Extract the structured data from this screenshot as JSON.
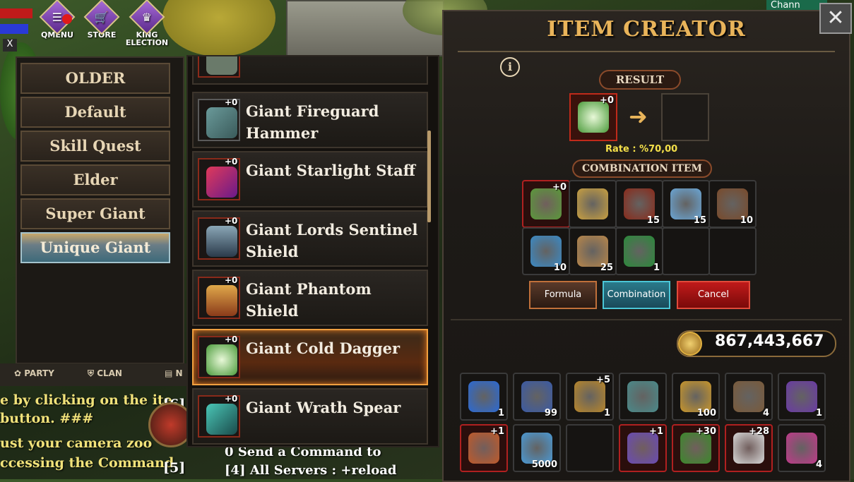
{
  "hud": {
    "buttons": [
      {
        "label": "QMENU",
        "icon": "menu-icon"
      },
      {
        "label": "STORE",
        "icon": "cart-icon"
      },
      {
        "label": "KING ELECTION",
        "icon": "crown-icon"
      }
    ],
    "close_small": "X",
    "channel_label": "Chann"
  },
  "categories": [
    {
      "label": "OLDER",
      "active": false
    },
    {
      "label": "Default",
      "active": false
    },
    {
      "label": "Skill Quest",
      "active": false
    },
    {
      "label": "Elder",
      "active": false
    },
    {
      "label": "Super Giant",
      "active": false
    },
    {
      "label": "Unique Giant",
      "active": true
    }
  ],
  "chat": {
    "tabs": [
      "PARTY",
      "CLAN",
      "N"
    ],
    "lines": [
      {
        "text": "e by clicking on the ite",
        "tag": "[6]"
      },
      {
        "text": "button. ###"
      },
      {
        "text": "ust your camera zoo"
      },
      {
        "text": "ccessing the Command",
        "tag": "[5]"
      },
      {
        "text": "Send a Command to",
        "tag": "0"
      },
      {
        "text": "All Servers : +reload",
        "tag": "[4]"
      }
    ]
  },
  "recipes": [
    {
      "name": "",
      "plus": "",
      "selected": false
    },
    {
      "name": "Giant Fireguard Hammer",
      "plus": "+0",
      "selected": false
    },
    {
      "name": "Giant Starlight Staff",
      "plus": "+0",
      "selected": false
    },
    {
      "name": "Giant Lords Sentinel Shield",
      "plus": "+0",
      "selected": false
    },
    {
      "name": "Giant Phantom Shield",
      "plus": "+0",
      "selected": false
    },
    {
      "name": "Giant Cold Dagger",
      "plus": "+0",
      "selected": true
    },
    {
      "name": "Giant Wrath Spear",
      "plus": "+0",
      "selected": false
    }
  ],
  "creator": {
    "title": "ITEM CREATOR",
    "close": "✕",
    "info": "i",
    "result_label": "RESULT",
    "result_item_plus": "+0",
    "rate": "Rate : %70,00",
    "combination_label": "COMBINATION ITEM",
    "combination_slots": [
      {
        "icon": "green-dagger-icon",
        "plus": "+0",
        "qty": "",
        "red": true,
        "color": "#5a9a3a"
      },
      {
        "icon": "gold-bar-icon",
        "plus": "",
        "qty": "",
        "red": false,
        "color": "#c9a040"
      },
      {
        "icon": "red-claw-icon",
        "plus": "",
        "qty": "15",
        "red": false,
        "color": "#8a2a1a"
      },
      {
        "icon": "crystal-icon",
        "plus": "",
        "qty": "15",
        "red": false,
        "color": "#6aa6d6"
      },
      {
        "icon": "scroll-book-icon",
        "plus": "",
        "qty": "10",
        "red": false,
        "color": "#7a4a2a"
      },
      {
        "icon": "blue-orb-icon",
        "plus": "",
        "qty": "10",
        "red": false,
        "color": "#3a8ac6"
      },
      {
        "icon": "gold-coin-icon",
        "plus": "",
        "qty": "25",
        "red": false,
        "color": "#b8864a"
      },
      {
        "icon": "green-triangle-icon",
        "plus": "",
        "qty": "1",
        "red": false,
        "color": "#2a8a3a"
      },
      {
        "icon": "",
        "plus": "",
        "qty": "",
        "red": false,
        "color": ""
      },
      {
        "icon": "",
        "plus": "",
        "qty": "",
        "red": false,
        "color": ""
      }
    ],
    "buttons": {
      "formula": "Formula",
      "combination": "Combination",
      "cancel": "Cancel"
    },
    "gold": "867,443,667"
  },
  "inventory": [
    {
      "icon": "blue-potion-icon",
      "plus": "",
      "qty": "1",
      "red": false,
      "color": "#2a6ad6"
    },
    {
      "icon": "rune-chest-icon",
      "plus": "",
      "qty": "99",
      "red": false,
      "color": "#3a5aa6"
    },
    {
      "icon": "gold-medallion-icon",
      "plus": "+5",
      "qty": "1",
      "red": false,
      "color": "#b8862a"
    },
    {
      "icon": "sword-icon",
      "plus": "",
      "qty": "",
      "red": false,
      "color": "#4a8a8a"
    },
    {
      "icon": "gold-token-icon",
      "plus": "",
      "qty": "100",
      "red": false,
      "color": "#c9962a"
    },
    {
      "icon": "treasure-chest-icon",
      "plus": "",
      "qty": "4",
      "red": false,
      "color": "#7a5a3a"
    },
    {
      "icon": "purple-m-icon",
      "plus": "",
      "qty": "1",
      "red": false,
      "color": "#6a3aa6"
    },
    {
      "icon": "fire-ring-icon",
      "plus": "+1",
      "qty": "",
      "red": true,
      "color": "#c05a2a"
    },
    {
      "icon": "mana-bottle-icon",
      "plus": "",
      "qty": "5000",
      "red": false,
      "color": "#4a9ad6"
    },
    {
      "icon": "",
      "plus": "",
      "qty": "",
      "red": false,
      "color": ""
    },
    {
      "icon": "pickaxe-icon",
      "plus": "+1",
      "qty": "",
      "red": true,
      "color": "#6a4ab6"
    },
    {
      "icon": "green-spear-icon",
      "plus": "+30",
      "qty": "",
      "red": true,
      "color": "#3a8a2a"
    },
    {
      "icon": "white-blade-icon",
      "plus": "+28",
      "qty": "",
      "red": true,
      "color": "#d8d8d8"
    },
    {
      "icon": "ms-badge-icon",
      "plus": "",
      "qty": "4",
      "red": false,
      "color": "#c03a8a"
    }
  ]
}
